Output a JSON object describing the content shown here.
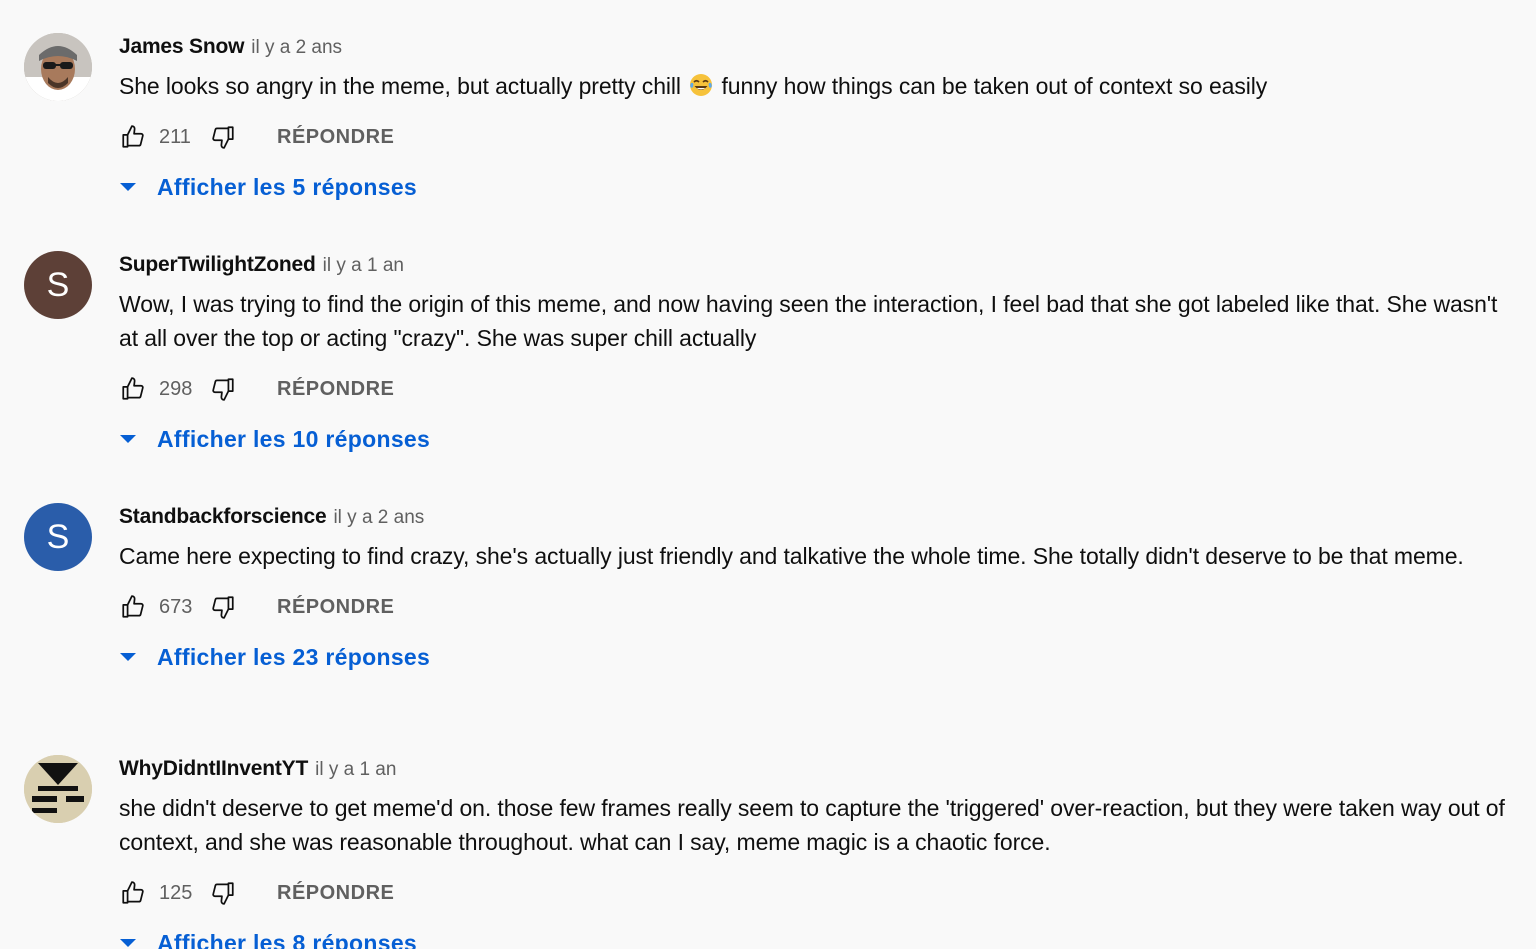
{
  "comments": [
    {
      "author": "James Snow",
      "time": "il y a 2 ans",
      "text_before": "She looks so angry in the meme, but actually pretty chill",
      "text_after": "funny how things can be taken out of context so easily",
      "emoji": "face-with-tears-of-joy",
      "likes": "211",
      "reply_label": "RÉPONDRE",
      "replies_label": "Afficher les 5 réponses",
      "avatar": {
        "type": "photo",
        "initial": "",
        "color": "#8a8a8a"
      }
    },
    {
      "author": "SuperTwilightZoned",
      "time": "il y a 1 an",
      "text": "Wow, I was trying to find the origin of this meme, and now having seen the interaction, I feel bad that she got labeled like that. She wasn't at all over the top or acting \"crazy\". She was super chill actually",
      "likes": "298",
      "reply_label": "RÉPONDRE",
      "replies_label": "Afficher les 10 réponses",
      "avatar": {
        "type": "initial",
        "initial": "S",
        "color": "#5d4037"
      }
    },
    {
      "author": "Standbackforscience",
      "time": "il y a 2 ans",
      "text": "Came here expecting to find crazy, she's actually just friendly and talkative the whole time. She totally didn't deserve to be that meme.",
      "likes": "673",
      "reply_label": "RÉPONDRE",
      "replies_label": "Afficher les 23 réponses",
      "avatar": {
        "type": "initial",
        "initial": "S",
        "color": "#2a5daa"
      }
    },
    {
      "author": "WhyDidntIInventYT",
      "time": "il y a 1 an",
      "text": "she didn't deserve to get meme'd on. those few frames really seem to capture the 'triggered' over-reaction, but they were taken way out of context, and she was reasonable throughout. what can I say, meme magic is a chaotic force.",
      "likes": "125",
      "reply_label": "RÉPONDRE",
      "replies_label": "Afficher les 8 réponses",
      "avatar": {
        "type": "logo",
        "initial": "",
        "color": "#d9cfb0"
      }
    }
  ],
  "colors": {
    "background": "#f9f9f9",
    "link": "#065fd4",
    "secondary_text": "#606060",
    "primary_text": "#0f0f0f"
  }
}
